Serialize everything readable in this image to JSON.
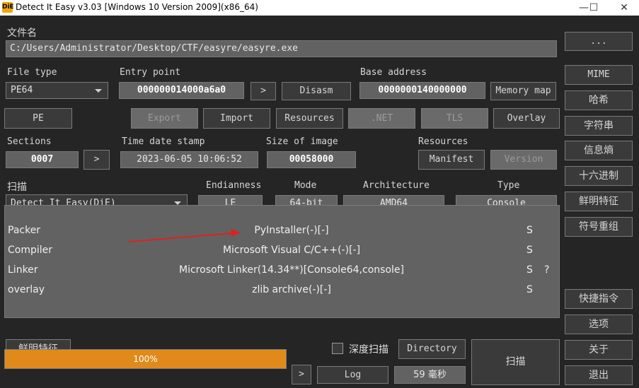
{
  "window": {
    "title": "Detect It Easy v3.03 [Windows 10 Version 2009](x86_64)",
    "icon_text": "DiE",
    "controls": [
      "—",
      "☐",
      "✕"
    ]
  },
  "file": {
    "label": "文件名",
    "path": "C:/Users/Administrator/Desktop/CTF/easyre/easyre.exe",
    "browse_label": "..."
  },
  "header": {
    "file_type_label": "File type",
    "file_type_value": "PE64",
    "entry_point_label": "Entry point",
    "entry_point_value": "000000014000a6a0",
    "entry_point_go": ">",
    "disasm_label": "Disasm",
    "base_address_label": "Base address",
    "base_address_value": "0000000140000000",
    "memory_map_label": "Memory map"
  },
  "toolbar": {
    "pe": "PE",
    "export": "Export",
    "import": "Import",
    "resources": "Resources",
    "net": ".NET",
    "tls": "TLS",
    "overlay": "Overlay"
  },
  "info": {
    "sections_label": "Sections",
    "sections_value": "0007",
    "sections_go": ">",
    "time_date_label": "Time date stamp",
    "time_date_value": "2023-06-05 10:06:52",
    "size_label": "Size of image",
    "size_value": "00058000",
    "resources_label": "Resources",
    "manifest": "Manifest",
    "version": "Version"
  },
  "scan": {
    "scan_label": "扫描",
    "engine": "Detect It Easy(DiE)",
    "endianness_label": "Endianness",
    "endianness_value": "LE",
    "mode_label": "Mode",
    "mode_value": "64-bit",
    "architecture_label": "Architecture",
    "architecture_value": "AMD64",
    "type_label": "Type",
    "type_value": "Console"
  },
  "results": [
    {
      "type": "Packer",
      "name": "PyInstaller(-)[-]",
      "flag": "S",
      "extra": ""
    },
    {
      "type": "Compiler",
      "name": "Microsoft Visual C/C++(-)[-]",
      "flag": "S",
      "extra": ""
    },
    {
      "type": "Linker",
      "name": "Microsoft Linker(14.34**)[Console64,console]",
      "flag": "S",
      "extra": "?"
    },
    {
      "type": "overlay",
      "name": "zlib archive(-)[-]",
      "flag": "S",
      "extra": ""
    }
  ],
  "bottom": {
    "signatures": "鲜明特征",
    "deep_scan": "深度扫描",
    "deep_scan_checked": false,
    "directory": "Directory",
    "scan": "扫描",
    "progress_text": "100%",
    "progress_value": 1.0,
    "go": ">",
    "log": "Log",
    "elapsed": "59 毫秒"
  },
  "sidebar": {
    "mime": "MIME",
    "hash": "哈希",
    "strings": "字符串",
    "entropy": "信息熵",
    "hex": "十六进制",
    "signatures": "鲜明特征",
    "demangle": "符号重组",
    "shortcuts": "快捷指令",
    "options": "选项",
    "about": "关于",
    "exit": "退出"
  },
  "colors": {
    "background": "#252525",
    "field": "#626262",
    "progress": "#e08a1c",
    "arrow": "#e02020"
  }
}
